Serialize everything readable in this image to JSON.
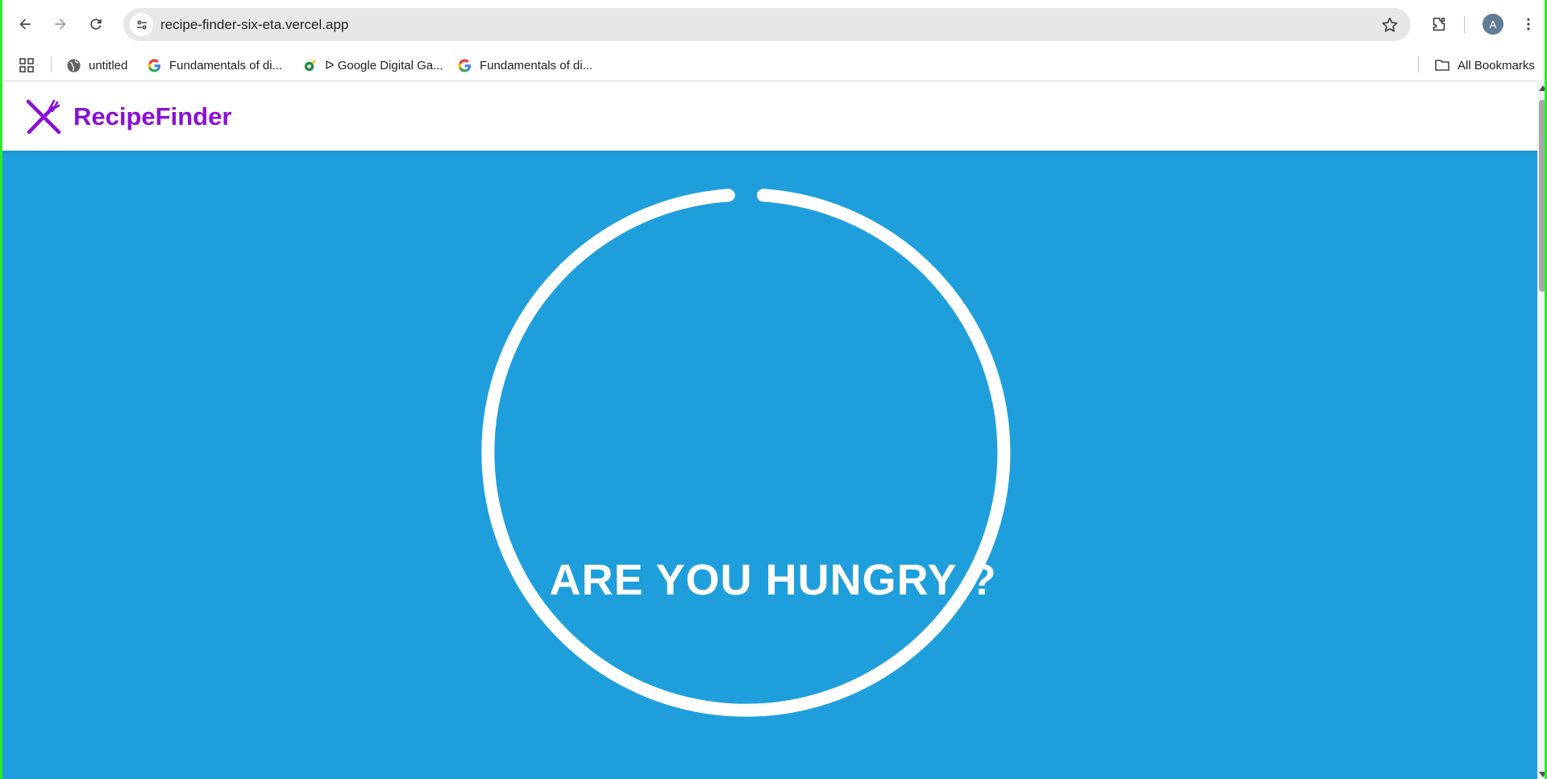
{
  "browser": {
    "url": "recipe-finder-six-eta.vercel.app",
    "profile_initial": "A",
    "bookmarks": [
      {
        "label": "untitled",
        "icon": "globe-icon"
      },
      {
        "label": "Fundamentals of di...",
        "icon": "google-icon"
      },
      {
        "label": "ᐅ Google Digital Ga...",
        "icon": "garage-icon"
      },
      {
        "label": "Fundamentals of di...",
        "icon": "google-icon"
      }
    ],
    "all_bookmarks_label": "All Bookmarks"
  },
  "site": {
    "brand": "RecipeFinder",
    "brand_color": "#8b10d6",
    "hero_color": "#1e9fdc",
    "hero_title": "ARE YOU HUNGRY ?"
  }
}
